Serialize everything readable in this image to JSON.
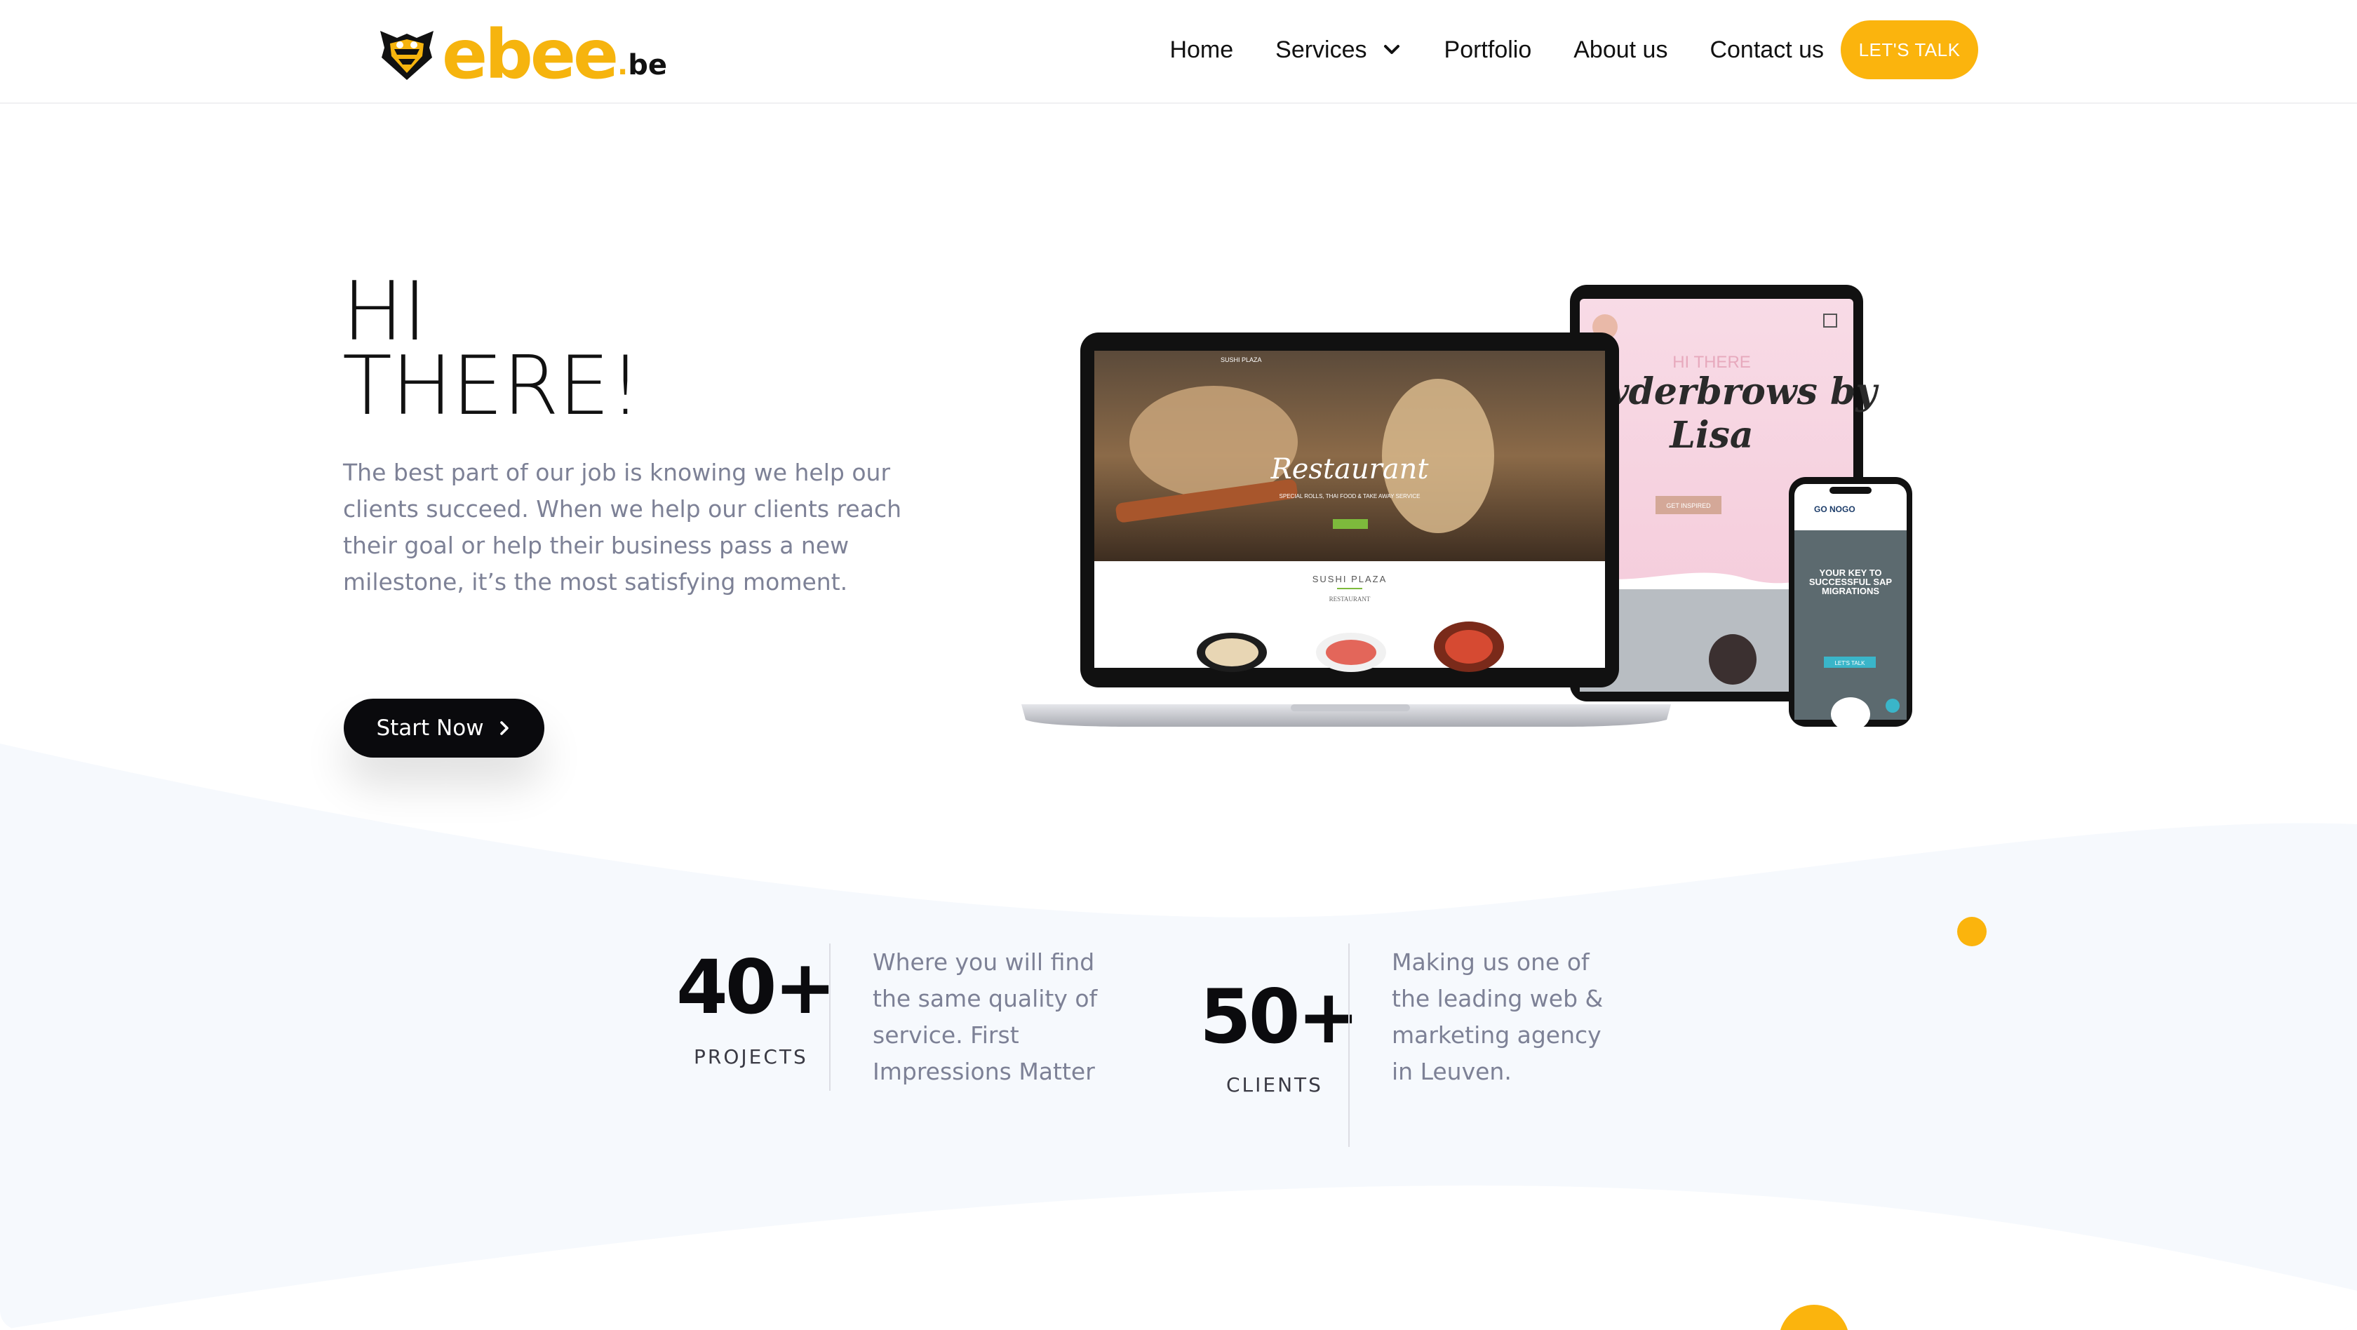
{
  "brand": {
    "name_main": "ebee",
    "name_tld_dot": ".",
    "name_tld": "be",
    "accent_color": "#fbb40d",
    "logo_icon": "bee-icon"
  },
  "nav": {
    "items": [
      {
        "label": "Home"
      },
      {
        "label": "Services",
        "icon": "chevron-down-icon"
      },
      {
        "label": "Portfolio"
      },
      {
        "label": "About us"
      },
      {
        "label": "Contact us"
      }
    ],
    "cta_label": "LET'S TALK"
  },
  "hero": {
    "title_line1": "HI",
    "title_line2": "THERE!",
    "text": "The best part of our job is knowing we help our clients succeed. When we help our clients reach their goal or help their business pass a new milestone, it’s the most satisfying moment.",
    "button_label": "Start Now",
    "button_icon": "chevron-right-icon"
  },
  "showcase": {
    "laptop": {
      "brand": "SUSHI PLAZA",
      "hero_script": "Restaurant",
      "tagline": "SPECIAL ROLLS, THAI FOOD & TAKE AWAY SERVICE",
      "section_title": "SUSHI PLAZA",
      "section_sub": "RESTAURANT"
    },
    "tablet": {
      "kicker": "HI THERE",
      "script_line1": "Powderbrows by",
      "script_line2": "Lisa",
      "button": "GET INSPIRED"
    },
    "phone": {
      "brand": "GO NOGO",
      "headline": "YOUR KEY TO SUCCESSFUL SAP MIGRATIONS",
      "button": "LET'S TALK"
    }
  },
  "stats": [
    {
      "value": "40+",
      "label": "PROJECTS",
      "description_lines": [
        "Where you will find",
        "the same quality of",
        "service. First",
        "Impressions Matter"
      ]
    },
    {
      "value": "50+",
      "label": "CLIENTS",
      "description_lines": [
        "Making us one of",
        "the leading web &",
        "marketing agency",
        "in Leuven."
      ]
    }
  ]
}
